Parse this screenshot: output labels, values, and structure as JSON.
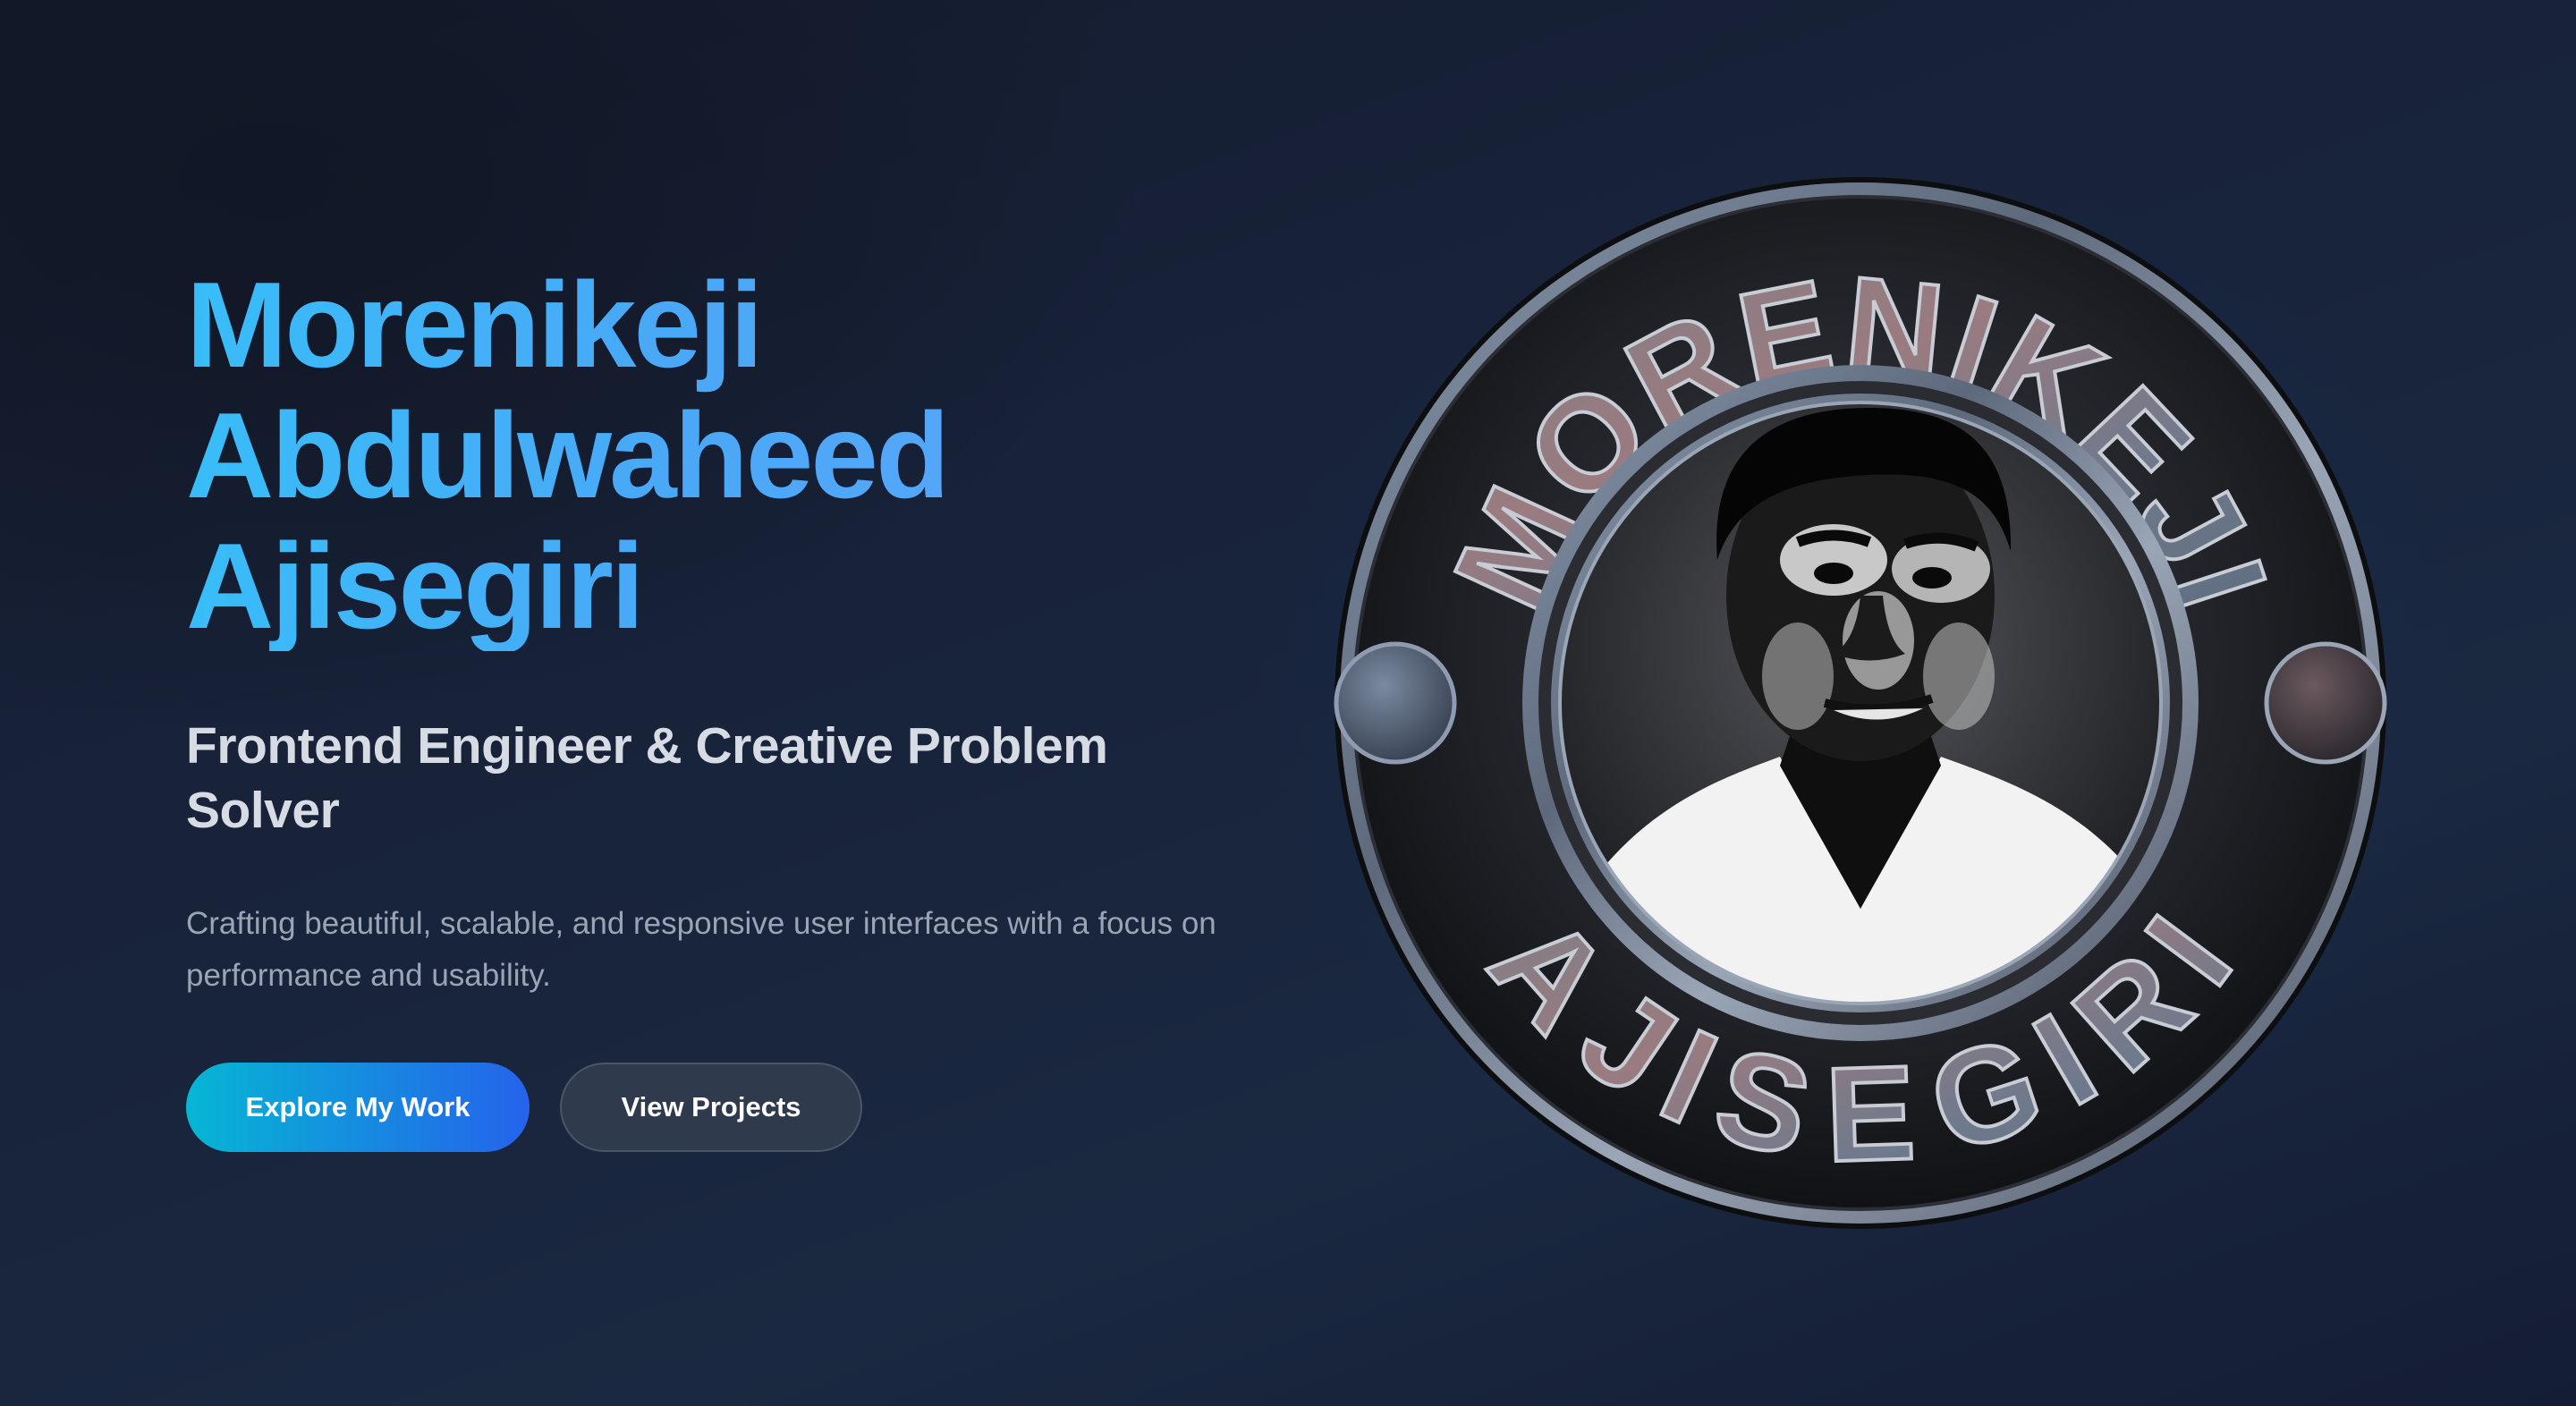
{
  "hero": {
    "name_lines": [
      "Morenikeji",
      "Abdulwaheed",
      "Ajisegiri"
    ],
    "subtitle": "Frontend Engineer & Creative Problem Solver",
    "description": "Crafting beautiful, scalable, and responsive user interfaces with a focus on performance and usability.",
    "primary_button": "Explore My Work",
    "secondary_button": "View Projects"
  },
  "emblem": {
    "top_text": "MORENIKEJI",
    "bottom_text": "AJISEGIRI"
  },
  "colors": {
    "name_gradient_start": "#38bdf8",
    "name_gradient_end": "#60a5fa",
    "button_gradient_start": "#06b6d4",
    "button_gradient_end": "#2563eb",
    "background": "#161f33"
  }
}
